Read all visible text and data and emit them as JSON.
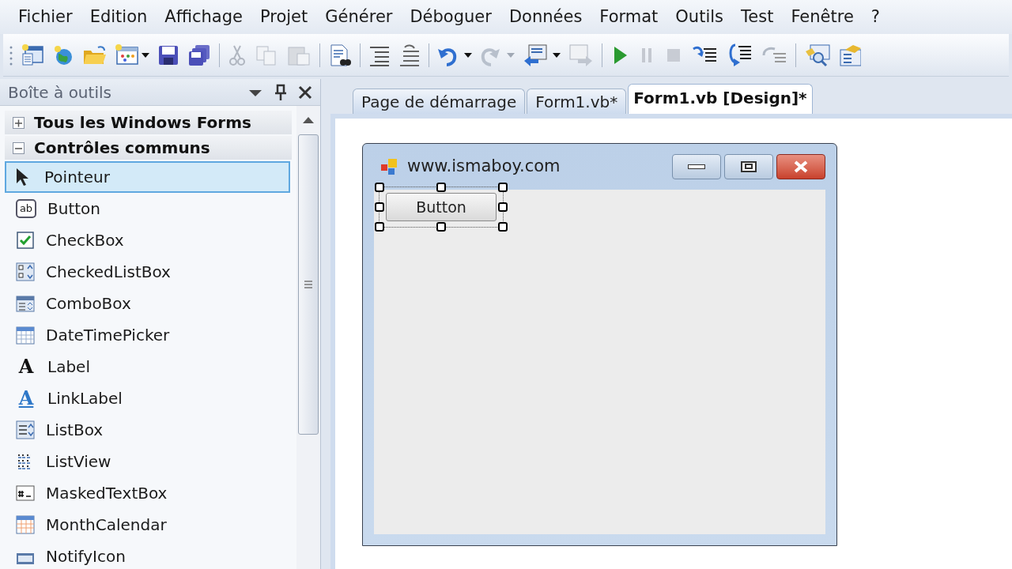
{
  "menu": [
    "Fichier",
    "Edition",
    "Affichage",
    "Projet",
    "Générer",
    "Déboguer",
    "Données",
    "Format",
    "Outils",
    "Test",
    "Fenêtre",
    "?"
  ],
  "toolbox": {
    "title": "Boîte à outils",
    "categories": [
      {
        "label": "Tous les Windows Forms",
        "expanded": false
      },
      {
        "label": "Contrôles communs",
        "expanded": true,
        "items": [
          {
            "label": "Pointeur",
            "selected": true
          },
          {
            "label": "Button",
            "selected": false,
            "icon_text": "ab"
          },
          {
            "label": "CheckBox",
            "selected": false
          },
          {
            "label": "CheckedListBox",
            "selected": false
          },
          {
            "label": "ComboBox",
            "selected": false
          },
          {
            "label": "DateTimePicker",
            "selected": false
          },
          {
            "label": "Label",
            "selected": false,
            "icon_text": "A"
          },
          {
            "label": "LinkLabel",
            "selected": false,
            "icon_text": "A"
          },
          {
            "label": "ListBox",
            "selected": false
          },
          {
            "label": "ListView",
            "selected": false
          },
          {
            "label": "MaskedTextBox",
            "selected": false
          },
          {
            "label": "MonthCalendar",
            "selected": false
          },
          {
            "label": "NotifyIcon",
            "selected": false
          }
        ]
      }
    ]
  },
  "tabs": [
    {
      "label": "Page de démarrage",
      "selected": false
    },
    {
      "label": "Form1.vb*",
      "selected": false
    },
    {
      "label": "Form1.vb [Design]*",
      "selected": true
    }
  ],
  "form": {
    "title": "www.ismaboy.com",
    "button": {
      "label": "Button",
      "selected": true
    }
  }
}
